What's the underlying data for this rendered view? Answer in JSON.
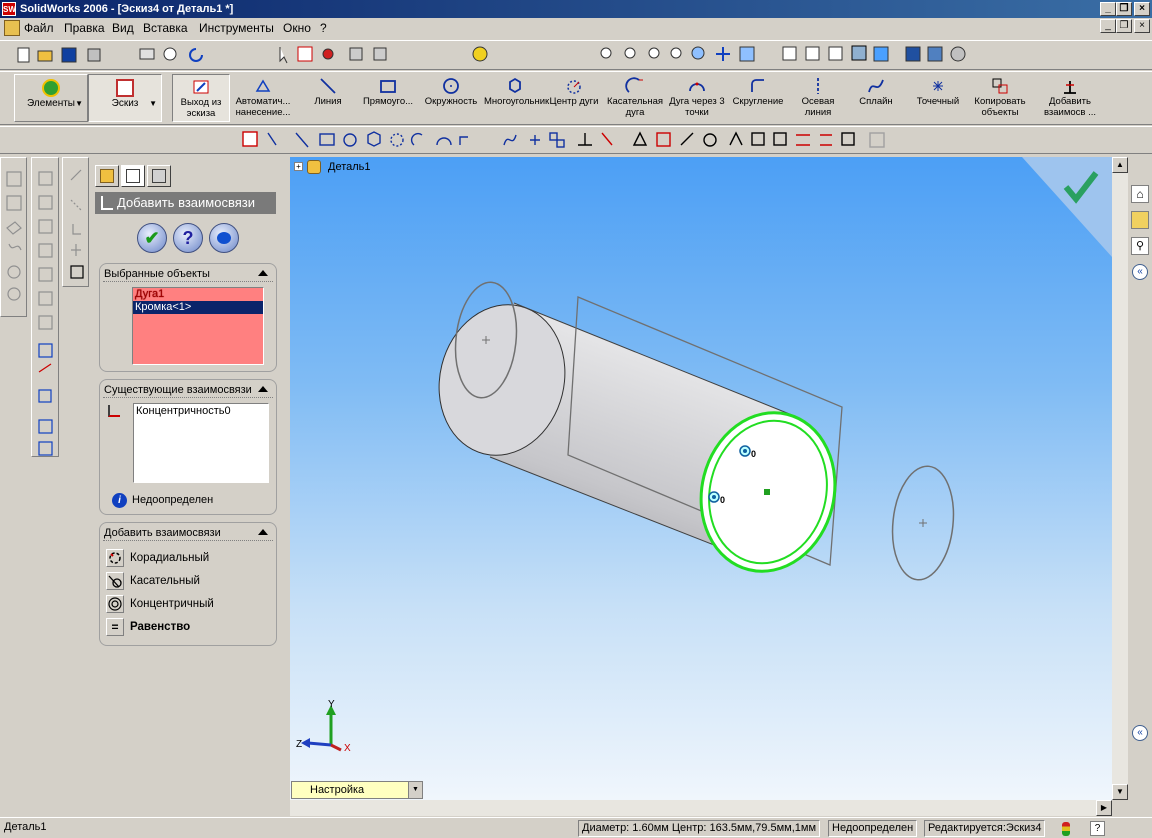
{
  "window": {
    "title": "SolidWorks 2006 - [Эскиз4 от Деталь1 *]"
  },
  "menu": [
    "Файл",
    "Правка",
    "Вид",
    "Вставка",
    "Инструменты",
    "Окно",
    "?"
  ],
  "command_manager": {
    "features_tab": "Элементы",
    "sketch_tab": "Эскиз",
    "commands": [
      {
        "label": "Выход из эскиза",
        "icon": "exit-sketch-icon"
      },
      {
        "label": "Автоматич... нанесение...",
        "icon": "smart-dimension-icon"
      },
      {
        "label": "Линия",
        "icon": "line-icon"
      },
      {
        "label": "Прямоуго...",
        "icon": "rectangle-icon"
      },
      {
        "label": "Окружность",
        "icon": "circle-icon"
      },
      {
        "label": "Многоугольник",
        "icon": "polygon-icon"
      },
      {
        "label": "Центр дуги",
        "icon": "centerpoint-arc-icon"
      },
      {
        "label": "Касательная дуга",
        "icon": "tangent-arc-icon"
      },
      {
        "label": "Дуга через 3 точки",
        "icon": "three-point-arc-icon"
      },
      {
        "label": "Скругление",
        "icon": "fillet-icon"
      },
      {
        "label": "Осевая линия",
        "icon": "centerline-icon"
      },
      {
        "label": "Сплайн",
        "icon": "spline-icon"
      },
      {
        "label": "Точечный",
        "icon": "point-icon"
      },
      {
        "label": "Копировать объекты",
        "icon": "copy-entities-icon"
      },
      {
        "label": "Добавить взаимосв ...",
        "icon": "add-relation-icon"
      }
    ]
  },
  "property_manager": {
    "title": "Добавить взаимосвязи",
    "selected_objects": {
      "header": "Выбранные объекты",
      "items": [
        "Дуга1",
        "Кромка<1>"
      ]
    },
    "existing_relations": {
      "header": "Существующие взаимосвязи",
      "items": [
        "Концентричность0"
      ],
      "status": "Недоопределен"
    },
    "add_relations": {
      "header": "Добавить взаимосвязи",
      "items": [
        "Корадиальный",
        "Касательный",
        "Концентричный",
        "Равенство"
      ]
    }
  },
  "viewport": {
    "tree_root": "Деталь1",
    "axis_labels": {
      "y": "Y",
      "z": "Z",
      "x": "X"
    },
    "markers": [
      "0",
      "0"
    ],
    "config_dropdown": "Настройка"
  },
  "status_bar": {
    "left": "Деталь1",
    "info": "Диаметр: 1.60мм  Центр: 163.5мм,79.5мм,1мм",
    "state": "Недоопределен",
    "editing": "Редактируется:Эскиз4"
  },
  "colors": {
    "title_bar": "#0a246a",
    "selection_list_bg": "#ff8080",
    "selected_row": "#0a246a",
    "highlight_green": "#22dd22",
    "viewport_top": "#4c9ff5",
    "viewport_bottom": "#f0f6fc"
  }
}
